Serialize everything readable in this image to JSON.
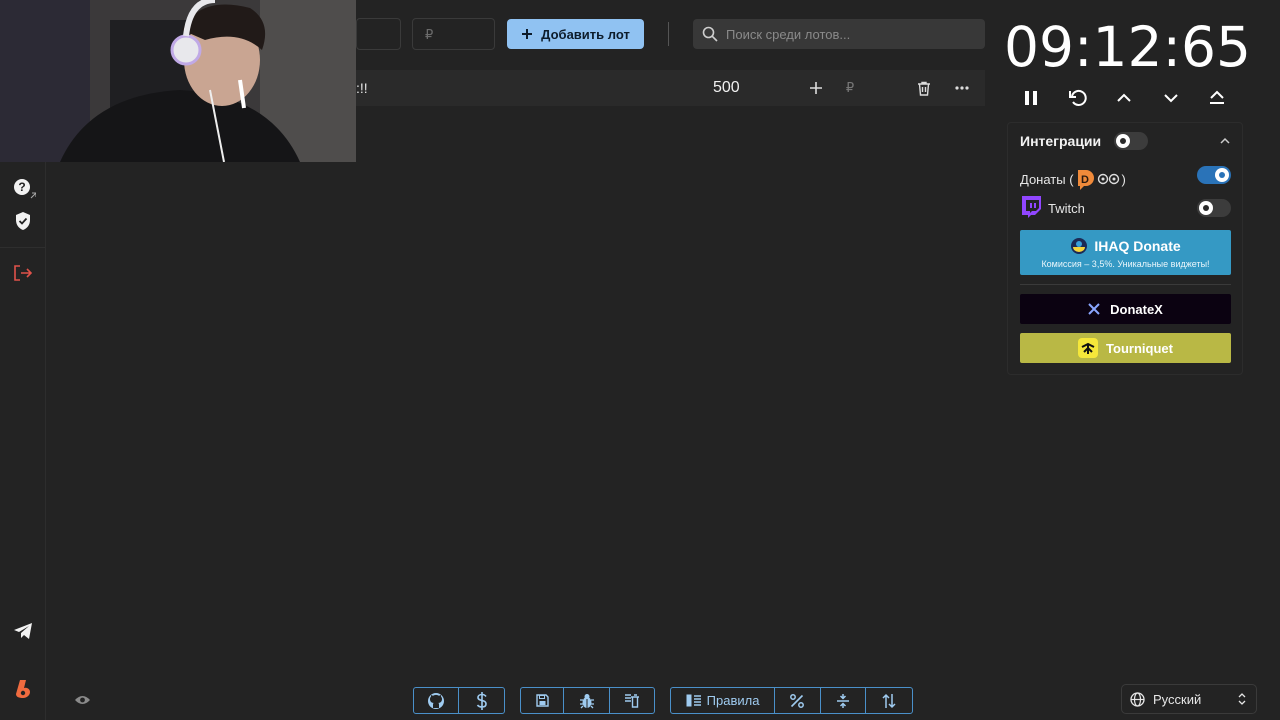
{
  "toolbar": {
    "currency_placeholder": "₽",
    "add_lot_label": "Добавить лот",
    "search_placeholder": "Поиск среди лотов..."
  },
  "lot": {
    "name": ":!!",
    "amount": "500",
    "currency_placeholder": "₽"
  },
  "timer": {
    "display": "09:12:65"
  },
  "integrations": {
    "title": "Интеграции",
    "enabled": false,
    "items": [
      {
        "label": "Донаты (",
        "label_suffix": ")",
        "enabled": true
      },
      {
        "label": "Twitch",
        "enabled": false
      }
    ],
    "ihaq": {
      "title": "IHAQ Donate",
      "subtitle": "Комиссия – 3,5%. Уникальные виджеты!"
    },
    "donatex": {
      "label": "DonateX"
    },
    "tourniquet": {
      "label": "Tourniquet"
    }
  },
  "bottom_toolbar": {
    "rules_label": "Правила"
  },
  "language": {
    "selected": "Русский"
  },
  "colors": {
    "accent": "#90c2f2",
    "toggle_on": "#2a73b8",
    "ihaq": "#3599c4",
    "donatex": "#0b0211",
    "tourniquet": "#b9b845",
    "logout": "#e0524a"
  }
}
